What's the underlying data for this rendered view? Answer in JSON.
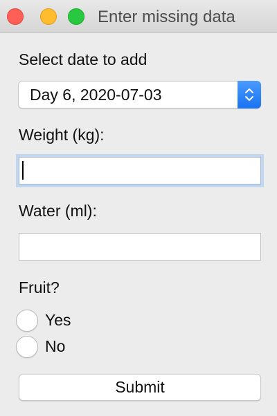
{
  "window": {
    "title": "Enter missing data",
    "controls": [
      "close-icon",
      "minimize-icon",
      "maximize-icon"
    ],
    "colors": {
      "close": "#fe5f57",
      "minimize": "#febc2e",
      "maximize": "#28c840",
      "accent": "#1a73f0"
    }
  },
  "date": {
    "label": "Select date to add",
    "selected": "Day 6, 2020-07-03"
  },
  "weight": {
    "label": "Weight (kg):",
    "value": ""
  },
  "water": {
    "label": "Water (ml):",
    "value": ""
  },
  "fruit": {
    "label": "Fruit?",
    "options": [
      "Yes",
      "No"
    ]
  },
  "submit": {
    "label": "Submit"
  }
}
